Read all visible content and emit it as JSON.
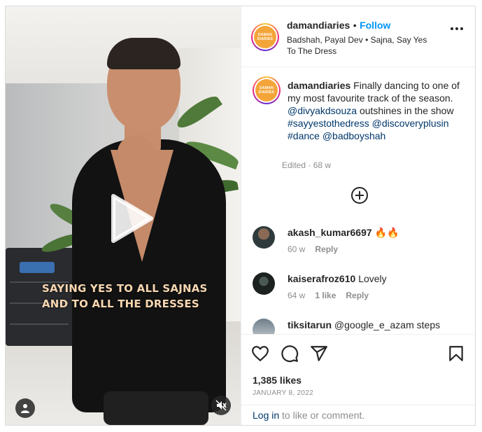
{
  "post": {
    "username": "damandiaries",
    "separator": "•",
    "follow_label": "Follow",
    "audio": "Badshah, Payal Dev • Sajna, Say Yes To The Dress",
    "logo_text": "DAMAN DIARIES",
    "video_overlay_text": "SAYING YES TO ALL SAJNAS AND TO ALL THE DRESSES"
  },
  "caption": {
    "username": "damandiaries",
    "text": "Finally dancing to one of my most favourite track of the season.",
    "mention_1": "@divyakdsouza",
    "text_2": "outshines in the show",
    "hashtag_1": "#sayyestothedress",
    "mention_2": "@discoveryplusin",
    "hashtag_2": "#dance",
    "mention_3": "@badboyshah",
    "edited_label": "Edited",
    "edited_dot": "·",
    "age": "68 w"
  },
  "comments": [
    {
      "username": "akash_kumar6697",
      "text": "🔥🔥",
      "age": "60 w",
      "likes": "",
      "reply": "Reply"
    },
    {
      "username": "kaiserafroz610",
      "text": "Lovely",
      "age": "64 w",
      "likes": "1 like",
      "reply": "Reply"
    },
    {
      "username": "tiksitarun",
      "text": "@google_e_azam steps",
      "age": "",
      "likes": "",
      "reply": ""
    }
  ],
  "footer": {
    "likes": "1,385 likes",
    "date": "JANUARY 8, 2022",
    "login_link": "Log in",
    "login_rest": "to like or comment."
  },
  "icons": [
    "play-icon",
    "user-tag-icon",
    "mute-icon",
    "more-options-icon",
    "add-comment-icon",
    "heart-icon",
    "comment-icon",
    "share-icon",
    "bookmark-icon"
  ],
  "colors": {
    "follow": "#0095f6",
    "link": "#00376b",
    "muted": "#8e8e8e",
    "logo": "#f4a53a"
  }
}
